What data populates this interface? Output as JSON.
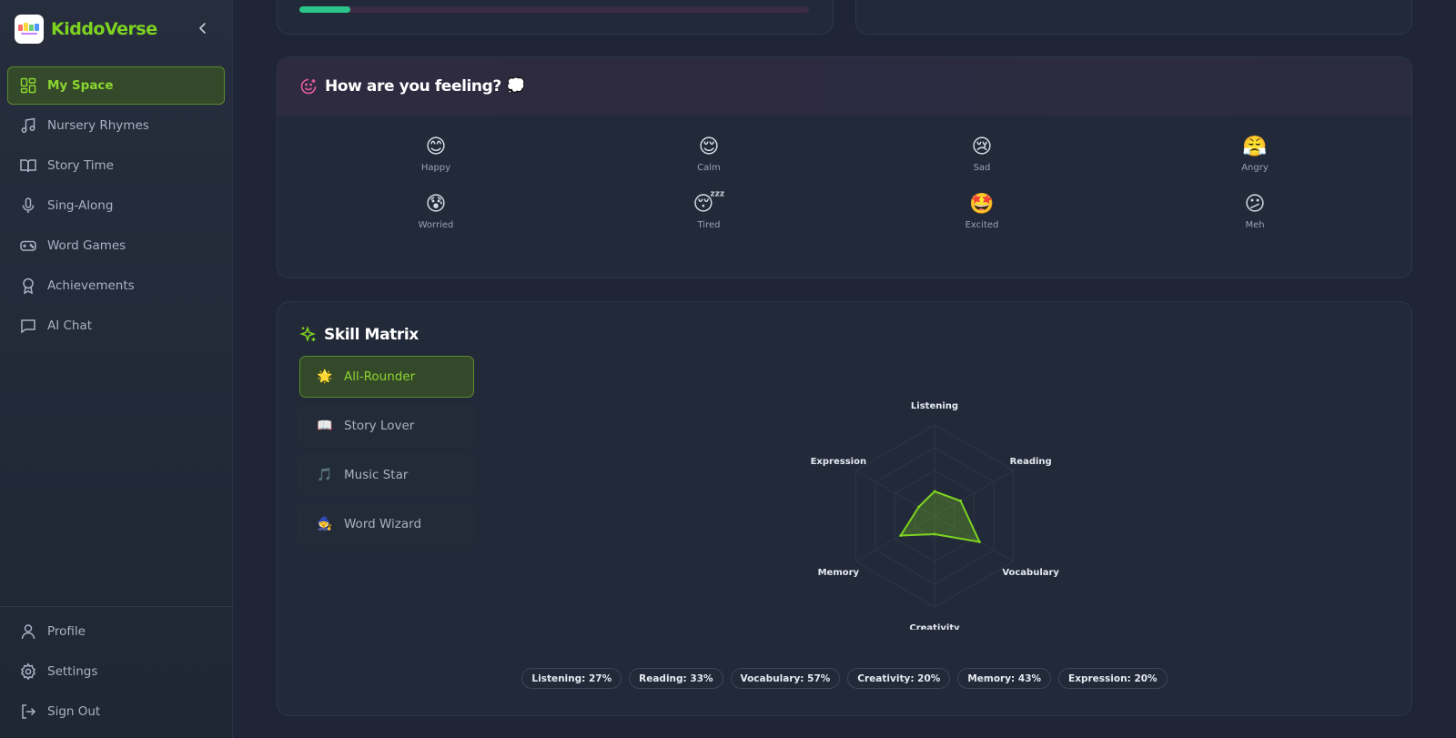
{
  "app": {
    "name": "KiddoVerse"
  },
  "sidebar": {
    "items": [
      {
        "label": "My Space",
        "icon": "grid-icon",
        "active": true
      },
      {
        "label": "Nursery Rhymes",
        "icon": "music-note-icon"
      },
      {
        "label": "Story Time",
        "icon": "book-icon"
      },
      {
        "label": "Sing-Along",
        "icon": "microphone-icon"
      },
      {
        "label": "Word Games",
        "icon": "gamepad-icon"
      },
      {
        "label": "Achievements",
        "icon": "award-icon"
      },
      {
        "label": "AI Chat",
        "icon": "chat-icon"
      }
    ],
    "bottom": [
      {
        "label": "Profile",
        "icon": "user-icon"
      },
      {
        "label": "Settings",
        "icon": "gear-icon"
      },
      {
        "label": "Sign Out",
        "icon": "sign-out-icon"
      }
    ]
  },
  "top_progress": {
    "value": 0.1
  },
  "mood": {
    "title": "How are you feeling? 💭",
    "options": [
      {
        "emoji": "😊",
        "label": "Happy"
      },
      {
        "emoji": "😌",
        "label": "Calm"
      },
      {
        "emoji": "😢",
        "label": "Sad"
      },
      {
        "emoji": "😤",
        "label": "Angry"
      },
      {
        "emoji": "😰",
        "label": "Worried"
      },
      {
        "emoji": "😴",
        "label": "Tired"
      },
      {
        "emoji": "🤩",
        "label": "Excited"
      },
      {
        "emoji": "😕",
        "label": "Meh"
      }
    ]
  },
  "skills": {
    "title": "Skill Matrix",
    "profiles": [
      {
        "emoji": "🌟",
        "label": "All-Rounder",
        "active": true
      },
      {
        "emoji": "📖",
        "label": "Story Lover"
      },
      {
        "emoji": "🎵",
        "label": "Music Star"
      },
      {
        "emoji": "🧙",
        "label": "Word Wizard"
      }
    ],
    "pills": [
      "Listening: 27%",
      "Reading: 33%",
      "Vocabulary: 57%",
      "Creativity: 20%",
      "Memory: 43%",
      "Expression: 20%"
    ]
  },
  "colors": {
    "accent": "#7ed321",
    "progress": "#2bc48a",
    "mood_icon": "#e85d9c"
  },
  "chart_data": {
    "type": "radar",
    "categories": [
      "Listening",
      "Reading",
      "Vocabulary",
      "Creativity",
      "Memory",
      "Expression"
    ],
    "values": [
      27,
      33,
      57,
      20,
      43,
      20
    ],
    "ylim": [
      0,
      100
    ]
  }
}
